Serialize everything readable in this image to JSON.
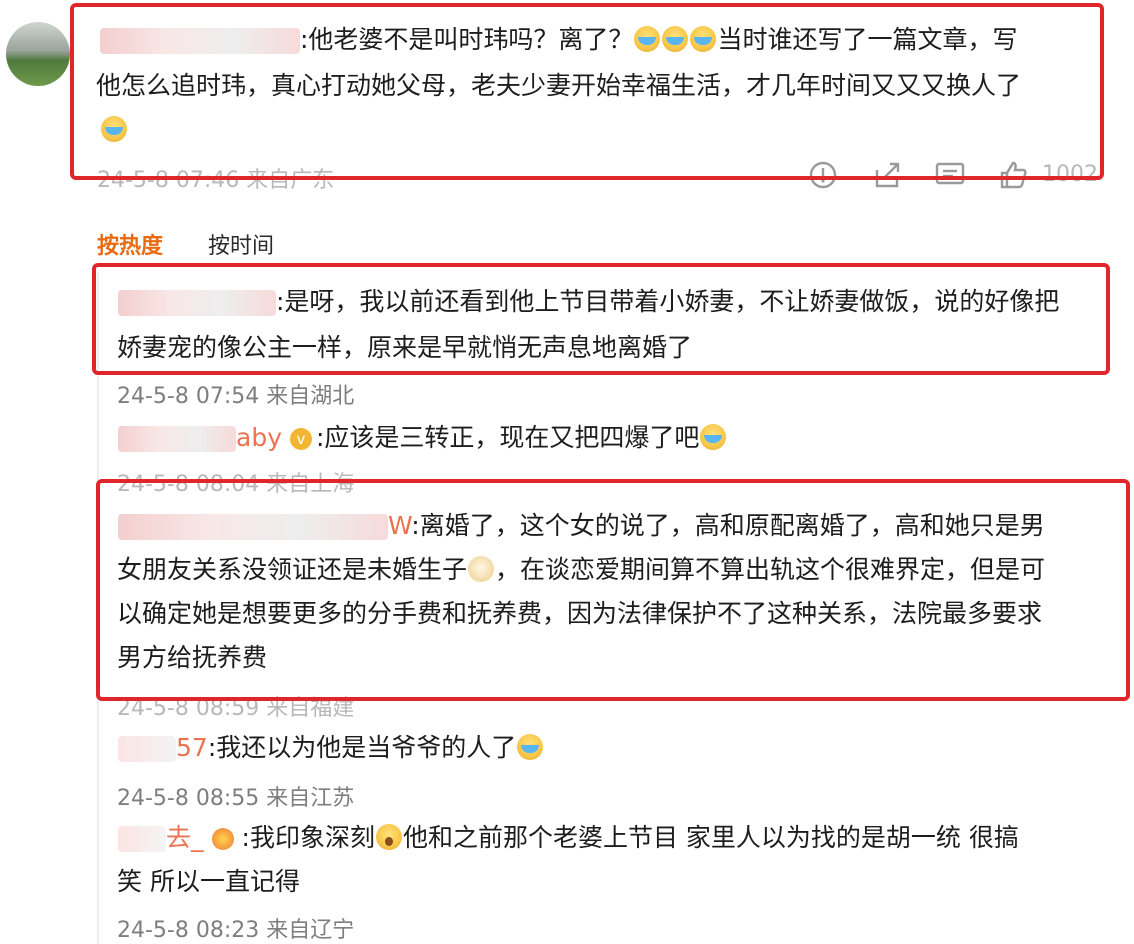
{
  "main_comment": {
    "text_line1": ":他老婆不是叫时玮吗？离了？",
    "text_line1_tail": "当时谁还写了一篇文章，写",
    "text_line2": "他怎么追时玮，真心打动她父母，老夫少妻开始幸福生活，才几年时间又又又换人了",
    "meta": "24-5-8 07:46 来自广东",
    "like_count": "1002"
  },
  "sort_tabs": {
    "hot": "按热度",
    "time": "按时间"
  },
  "replies": [
    {
      "lines": [
        ":是呀，我以前还看到他上节目带着小娇妻，不让娇妻做饭，说的好像把",
        "娇妻宠的像公主一样，原来是早就悄无声息地离婚了"
      ],
      "meta": "24-5-8 07:54 来自湖北"
    },
    {
      "name_tail": "aby",
      "lines": [
        ":应该是三转正，现在又把四爆了吧"
      ],
      "meta": "24-5-8 08:04 来自上海"
    },
    {
      "name_tail": "W",
      "lines": [
        ":离婚了，这个女的说了，高和原配离婚了，高和她只是男",
        "女朋友关系没领证还是未婚生子",
        "，在谈恋爱期间算不算出轨这个很难界定，但是可",
        "以确定她是想要更多的分手费和抚养费，因为法律保护不了这种关系，法院最多要求",
        "男方给抚养费"
      ],
      "meta": "24-5-8 08:59 来自福建"
    },
    {
      "name_tail": "57",
      "lines": [
        ":我还以为他是当爷爷的人了"
      ],
      "meta": "24-5-8 08:55 来自江苏"
    },
    {
      "name_tail": "去_",
      "lines": [
        ":我印象深刻",
        "他和之前那个老婆上节目  家里人以为找的是胡一统 很搞",
        "笑  所以一直记得"
      ],
      "meta": "24-5-8 08:23 来自辽宁"
    }
  ]
}
